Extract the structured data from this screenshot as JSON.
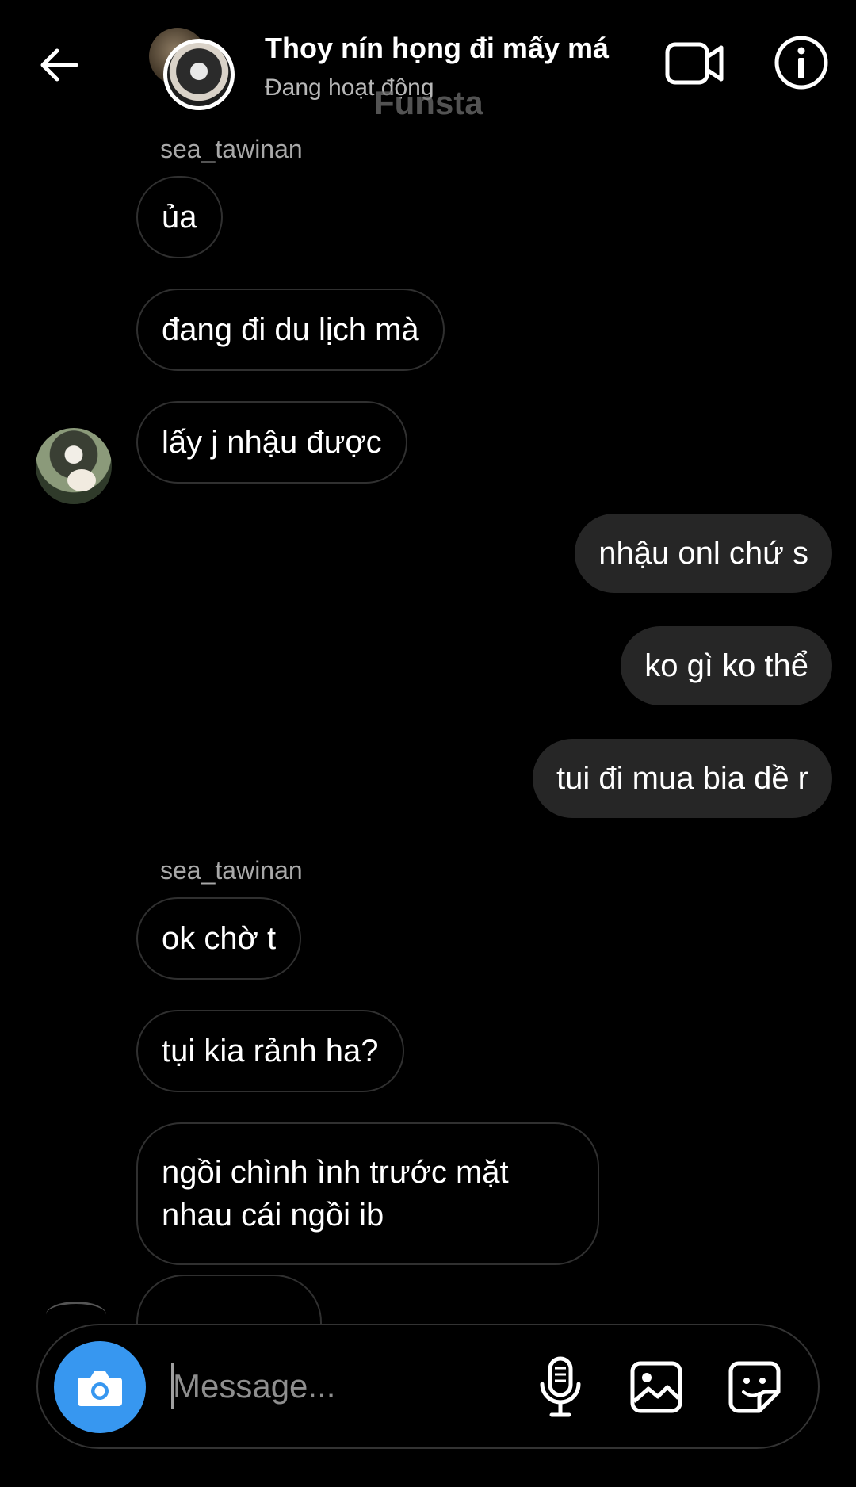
{
  "header": {
    "title": "Thoy nín họng đi mấy má",
    "status": "Đang hoạt động",
    "watermark": "Funsta"
  },
  "messages": [
    {
      "type": "sender_name",
      "text": "sea_tawinan"
    },
    {
      "type": "incoming",
      "text": "ủa"
    },
    {
      "type": "incoming",
      "text": "đang đi du lịch mà"
    },
    {
      "type": "incoming",
      "text": "lấy j nhậu được"
    },
    {
      "type": "outgoing",
      "text": "nhậu onl chứ s"
    },
    {
      "type": "outgoing",
      "text": "ko gì ko thể"
    },
    {
      "type": "outgoing",
      "text": "tui đi mua bia dề r"
    },
    {
      "type": "sender_name",
      "text": "sea_tawinan"
    },
    {
      "type": "incoming",
      "text": "ok chờ t"
    },
    {
      "type": "incoming",
      "text": "tụi kia rảnh ha?"
    },
    {
      "type": "incoming",
      "text": "ngồi chình ình trước mặt nhau cái ngồi ib"
    }
  ],
  "composer": {
    "placeholder": "Message..."
  },
  "icons": {
    "back": "arrow-left-icon",
    "video": "video-call-icon",
    "info": "info-icon",
    "camera": "camera-icon",
    "mic": "microphone-icon",
    "gallery": "image-gallery-icon",
    "sticker": "sticker-icon"
  },
  "colors": {
    "background": "#000000",
    "outgoing_bubble": "#262626",
    "incoming_border": "#303030",
    "camera_button": "#3797f0",
    "secondary_text": "#a8a8a8"
  }
}
